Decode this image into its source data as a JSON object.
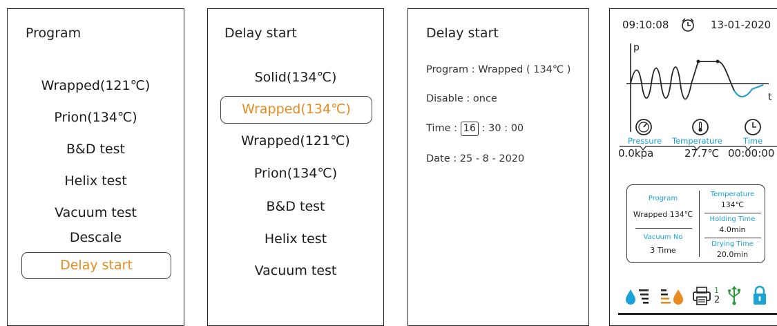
{
  "program_panel": {
    "title": "Program",
    "items": [
      "Wrapped(121℃)",
      "Prion(134℃)",
      "B&D test",
      "Helix test",
      "Vacuum test",
      "Descale"
    ],
    "selected": "Delay start"
  },
  "delay_panel": {
    "title": "Delay start",
    "item_first": "Solid(134℃)",
    "selected": "Wrapped(134℃)",
    "items": [
      "Wrapped(121℃)",
      "Prion(134℃)",
      "B&D test",
      "Helix test",
      "Vacuum test"
    ]
  },
  "delay_detail": {
    "title": "Delay start",
    "program_line": "Program : Wrapped ( 134℃ )",
    "disable_line": "Disable : once",
    "time_label": "Time :",
    "time_hour": "16",
    "time_rest": ": 30 : 00",
    "date_line": "Date : 25 - 8 - 2020"
  },
  "status_panel": {
    "clock": "09:10:08",
    "date": "13-01-2020",
    "graph": {
      "y_axis": "p",
      "x_axis": "t"
    },
    "gauges": [
      {
        "label": "Pressure",
        "value": "0.0kpa",
        "icon": "pressure-gauge-icon"
      },
      {
        "label": "Temperature",
        "value": "27.7℃",
        "icon": "thermometer-icon"
      },
      {
        "label": "Time",
        "value": "00:00:00",
        "icon": "clock-icon"
      }
    ],
    "info": {
      "program_label": "Program",
      "program_value": "Wrapped 134℃",
      "vacuum_label": "Vacuum No",
      "vacuum_value": "3 Time",
      "temperature_label": "Temperature",
      "temperature_value": "134℃",
      "holding_label": "Holding Time",
      "holding_value": "4.0min",
      "drying_label": "Drying Time",
      "drying_value": "20.0min"
    },
    "printer_numbers": [
      "1",
      "2"
    ],
    "accent_color": "#1aa3d6",
    "highlight_color": "#e98a1f"
  }
}
